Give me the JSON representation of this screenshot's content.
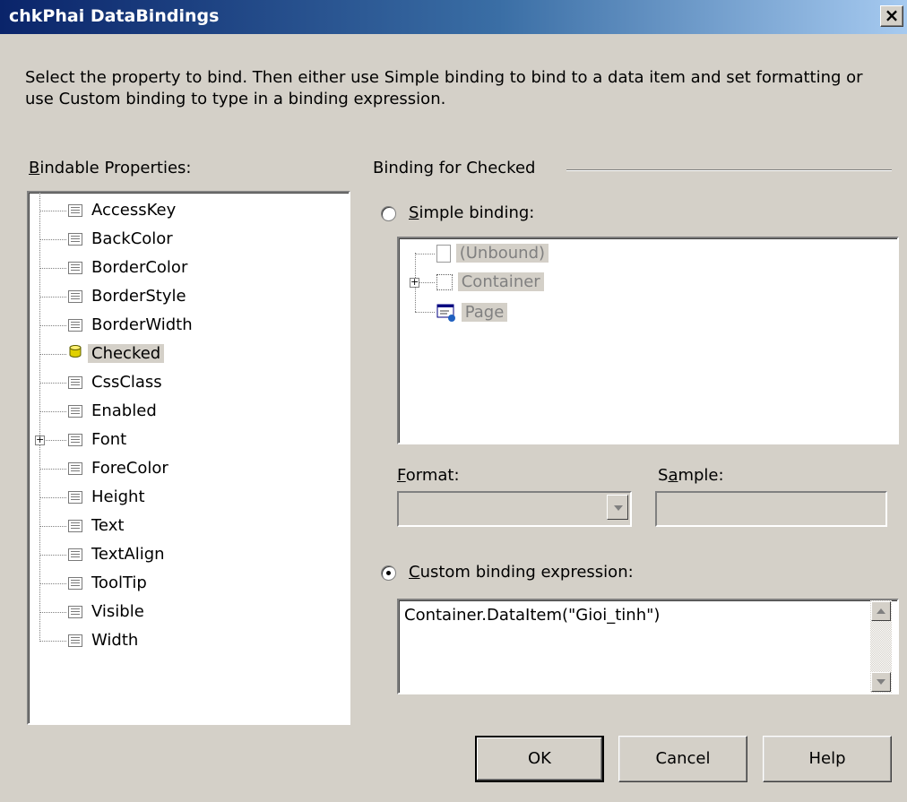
{
  "window": {
    "title": "chkPhai DataBindings",
    "close_label": "×"
  },
  "description": "Select the property to bind. Then either use Simple binding to bind to a data item and set formatting or use Custom binding to type in a binding expression.",
  "bindable": {
    "label_mnemonic": "B",
    "label_rest": "indable Properties:",
    "items": [
      {
        "label": "AccessKey",
        "icon": "property-icon",
        "expandable": false,
        "selected": false
      },
      {
        "label": "BackColor",
        "icon": "property-icon",
        "expandable": false,
        "selected": false
      },
      {
        "label": "BorderColor",
        "icon": "property-icon",
        "expandable": false,
        "selected": false
      },
      {
        "label": "BorderStyle",
        "icon": "property-icon",
        "expandable": false,
        "selected": false
      },
      {
        "label": "BorderWidth",
        "icon": "property-icon",
        "expandable": false,
        "selected": false
      },
      {
        "label": "Checked",
        "icon": "database-bound-icon",
        "expandable": false,
        "selected": true
      },
      {
        "label": "CssClass",
        "icon": "property-icon",
        "expandable": false,
        "selected": false
      },
      {
        "label": "Enabled",
        "icon": "property-icon",
        "expandable": false,
        "selected": false
      },
      {
        "label": "Font",
        "icon": "property-icon",
        "expandable": true,
        "selected": false
      },
      {
        "label": "ForeColor",
        "icon": "property-icon",
        "expandable": false,
        "selected": false
      },
      {
        "label": "Height",
        "icon": "property-icon",
        "expandable": false,
        "selected": false
      },
      {
        "label": "Text",
        "icon": "property-icon",
        "expandable": false,
        "selected": false
      },
      {
        "label": "TextAlign",
        "icon": "property-icon",
        "expandable": false,
        "selected": false
      },
      {
        "label": "ToolTip",
        "icon": "property-icon",
        "expandable": false,
        "selected": false
      },
      {
        "label": "Visible",
        "icon": "property-icon",
        "expandable": false,
        "selected": false
      },
      {
        "label": "Width",
        "icon": "property-icon",
        "expandable": false,
        "selected": false
      }
    ]
  },
  "binding": {
    "group_title": "Binding for Checked",
    "simple": {
      "mnemonic": "S",
      "label_rest": "imple binding:",
      "selected": false,
      "tree": [
        {
          "label": "(Unbound)",
          "icon": "unbound-icon"
        },
        {
          "label": "Container",
          "icon": "container-icon"
        },
        {
          "label": "Page",
          "icon": "page-icon"
        }
      ]
    },
    "format": {
      "mnemonic": "F",
      "label_rest": "ormat:",
      "value": ""
    },
    "sample": {
      "label_pre": "S",
      "mnemonic": "a",
      "label_rest": "mple:",
      "value": ""
    },
    "custom": {
      "mnemonic": "C",
      "label_rest": "ustom binding expression:",
      "selected": true,
      "expression": "Container.DataItem(\"Gioi_tinh\")"
    }
  },
  "buttons": {
    "ok": "OK",
    "cancel": "Cancel",
    "help": "Help"
  }
}
